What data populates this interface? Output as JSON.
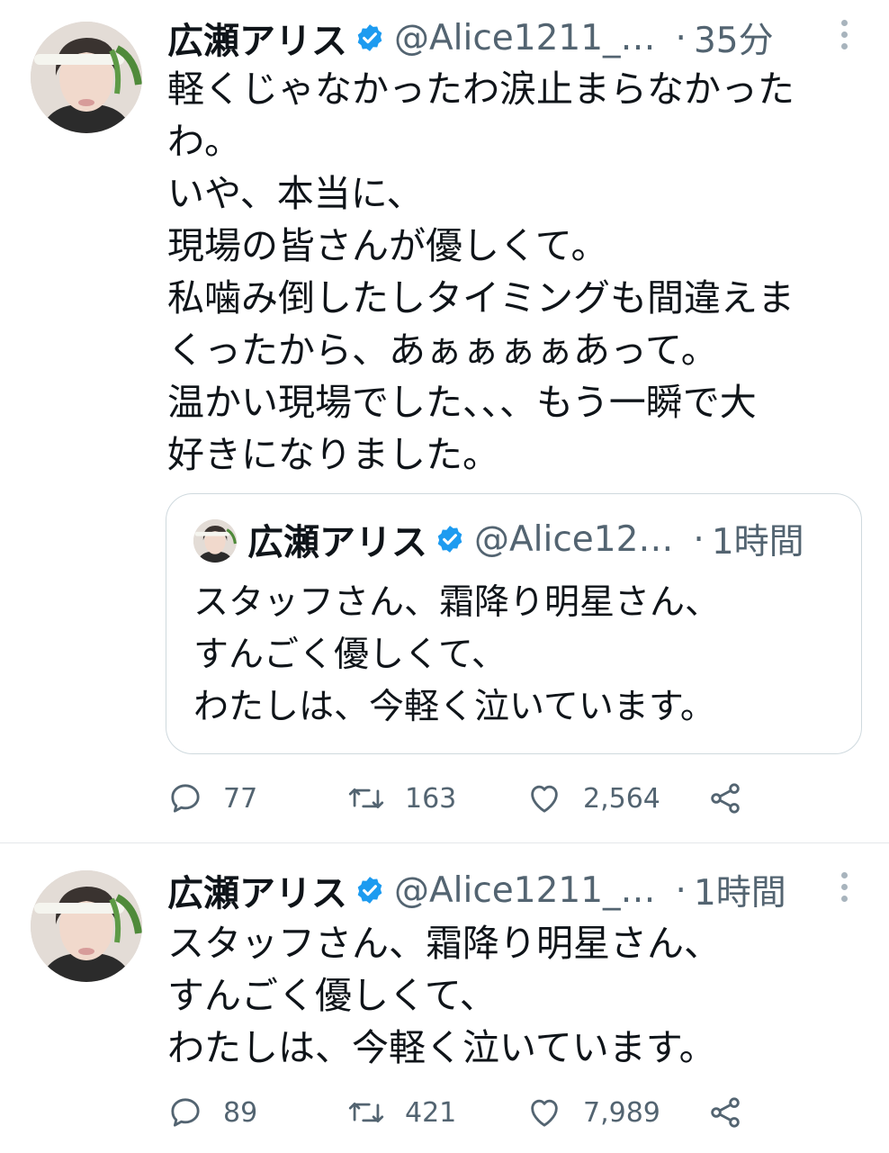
{
  "tweets": [
    {
      "name": "広瀬アリス",
      "handle": "@Alice1211_…",
      "separator": "·",
      "time": "35分",
      "lines": [
        "軽くじゃなかったわ涙止まらなかった",
        "わ。",
        "いや、本当に、",
        "現場の皆さんが優しくて。",
        "私噛み倒したしタイミングも間違えま",
        "くったから、あぁぁぁぁあって。",
        "温かい現場でした、、、もう一瞬で大",
        "好きになりました。"
      ],
      "quote": {
        "name": "広瀬アリス",
        "handle": "@Alice12…",
        "separator": "·",
        "time": "1時間",
        "lines": [
          "スタッフさん、霜降り明星さん、",
          "すんごく優しくて、",
          "わたしは、今軽く泣いています。"
        ]
      },
      "stats": {
        "replies": "77",
        "retweets": "163",
        "likes": "2,564"
      }
    },
    {
      "name": "広瀬アリス",
      "handle": "@Alice1211_…",
      "separator": "·",
      "time": "1時間",
      "lines": [
        "スタッフさん、霜降り明星さん、",
        "すんごく優しくて、",
        "わたしは、今軽く泣いています。"
      ],
      "stats": {
        "replies": "89",
        "retweets": "421",
        "likes": "7,989"
      }
    }
  ],
  "colors": {
    "verified": "#1d9bf0",
    "secondary_text": "#536471",
    "icon": "#536471"
  },
  "icons": {
    "verified": "verified-badge-icon",
    "more": "more-vertical-icon",
    "reply": "reply-icon",
    "retweet": "retweet-icon",
    "like": "heart-icon",
    "share": "share-icon"
  }
}
